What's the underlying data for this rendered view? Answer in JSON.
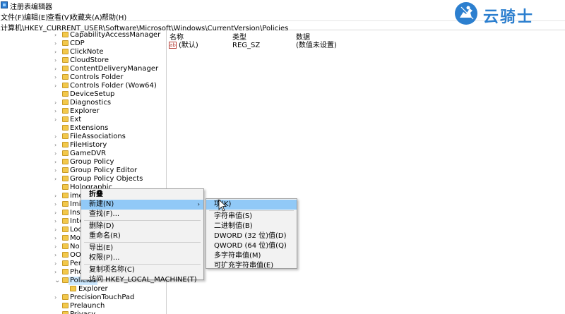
{
  "window": {
    "title": "注册表编辑器"
  },
  "menu": [
    "文件(F)",
    "编辑(E)",
    "查看(V)",
    "收藏夹(A)",
    "帮助(H)"
  ],
  "address": "计算机\\HKEY_CURRENT_USER\\Software\\Microsoft\\Windows\\CurrentVersion\\Policies",
  "tree": [
    {
      "label": "CapabilityAccessManager",
      "expander": true
    },
    {
      "label": "CDP",
      "expander": true
    },
    {
      "label": "ClickNote",
      "expander": true
    },
    {
      "label": "CloudStore",
      "expander": true
    },
    {
      "label": "ContentDeliveryManager",
      "expander": true
    },
    {
      "label": "Controls Folder",
      "expander": true
    },
    {
      "label": "Controls Folder (Wow64)",
      "expander": true
    },
    {
      "label": "DeviceSetup",
      "expander": false
    },
    {
      "label": "Diagnostics",
      "expander": true
    },
    {
      "label": "Explorer",
      "expander": true
    },
    {
      "label": "Ext",
      "expander": true
    },
    {
      "label": "Extensions",
      "expander": false
    },
    {
      "label": "FileAssociations",
      "expander": true
    },
    {
      "label": "FileHistory",
      "expander": true
    },
    {
      "label": "GameDVR",
      "expander": true
    },
    {
      "label": "Group Policy",
      "expander": true
    },
    {
      "label": "Group Policy Editor",
      "expander": true
    },
    {
      "label": "Group Policy Objects",
      "expander": true
    },
    {
      "label": "Holographic",
      "expander": false
    },
    {
      "label": "ime",
      "expander": true
    },
    {
      "label": "Imi",
      "expander": true
    },
    {
      "label": "Ins",
      "expander": true
    },
    {
      "label": "Inte",
      "expander": true
    },
    {
      "label": "Loc",
      "expander": true
    },
    {
      "label": "Mo",
      "expander": true
    },
    {
      "label": "No",
      "expander": true
    },
    {
      "label": "OO",
      "expander": true
    },
    {
      "label": "Per",
      "expander": true
    },
    {
      "label": "Pho",
      "expander": true
    },
    {
      "label": "Policies",
      "expander": true,
      "expanded": true,
      "selected": true
    },
    {
      "label": "Explorer",
      "expander": false,
      "child": true
    },
    {
      "label": "PrecisionTouchPad",
      "expander": true
    },
    {
      "label": "Prelaunch",
      "expander": false
    },
    {
      "label": "Privacy",
      "expander": false
    }
  ],
  "list": {
    "headers": {
      "name": "名称",
      "type": "类型",
      "data": "数据"
    },
    "rows": [
      {
        "icon": "ab",
        "name": "(默认)",
        "type": "REG_SZ",
        "data": "(数值未设置)"
      }
    ]
  },
  "context_menu": {
    "items": [
      {
        "label": "折叠",
        "bold": true
      },
      {
        "label": "新建(N)",
        "submenu": true,
        "highlighted": true
      },
      {
        "label": "查找(F)..."
      },
      {
        "label": "删除(D)",
        "sep_before": true
      },
      {
        "label": "重命名(R)"
      },
      {
        "label": "导出(E)",
        "sep_before": true
      },
      {
        "label": "权限(P)..."
      },
      {
        "label": "复制项名称(C)",
        "sep_before": true
      },
      {
        "label": "访问 HKEY_LOCAL_MACHINE(T)"
      }
    ]
  },
  "submenu": {
    "items": [
      {
        "label": "项(K)",
        "highlighted": true
      },
      {
        "label": "字符串值(S)",
        "sep_before": true
      },
      {
        "label": "二进制值(B)"
      },
      {
        "label": "DWORD (32 位)值(D)"
      },
      {
        "label": "QWORD (64 位)值(Q)"
      },
      {
        "label": "多字符串值(M)"
      },
      {
        "label": "可扩充字符串值(E)"
      }
    ]
  },
  "logo": {
    "text": "云骑士",
    "color": "#2c7fcf"
  },
  "colors": {
    "selection": "#cce8ff",
    "menu_highlight": "#91c9f7",
    "folder": "#f2c84b"
  }
}
